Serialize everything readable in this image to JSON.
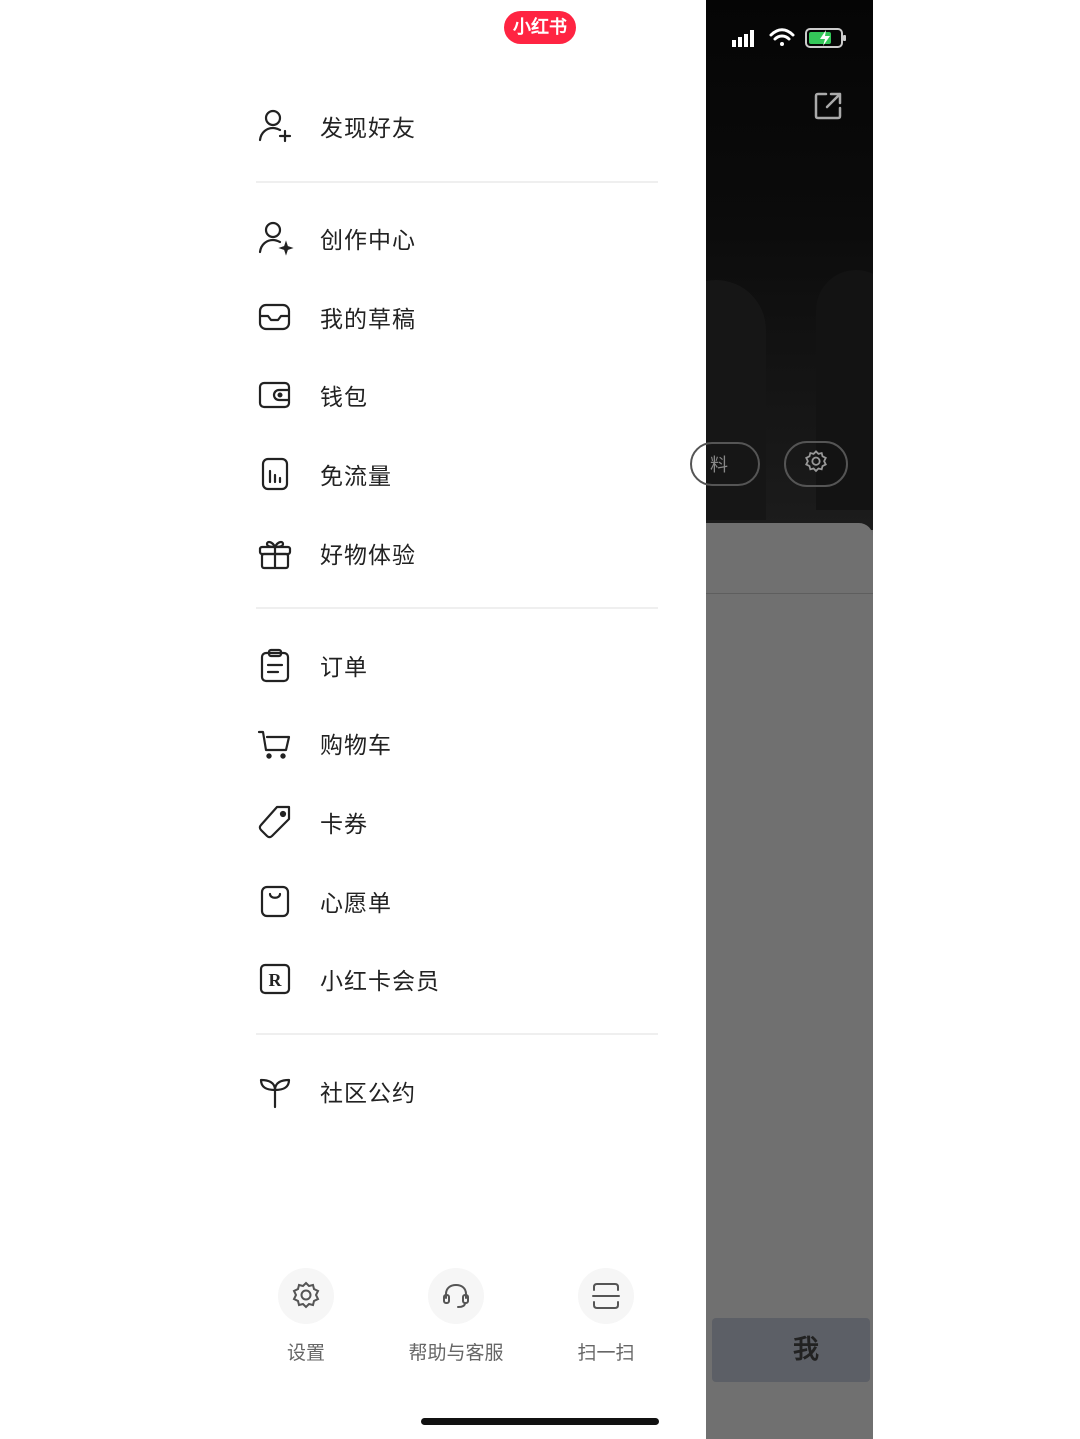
{
  "app": {
    "logo_text": "小红书",
    "brand_color": "#ff2442"
  },
  "drawer": {
    "groups": [
      {
        "items": [
          {
            "label": "发现好友",
            "icon": "add-friend-icon"
          }
        ]
      },
      {
        "items": [
          {
            "label": "创作中心",
            "icon": "creator-center-icon"
          },
          {
            "label": "我的草稿",
            "icon": "drafts-icon"
          },
          {
            "label": "钱包",
            "icon": "wallet-icon"
          },
          {
            "label": "免流量",
            "icon": "free-data-icon"
          },
          {
            "label": "好物体验",
            "icon": "gift-icon"
          }
        ]
      },
      {
        "items": [
          {
            "label": "订单",
            "icon": "clipboard-icon"
          },
          {
            "label": "购物车",
            "icon": "cart-icon"
          },
          {
            "label": "卡券",
            "icon": "coupon-tag-icon"
          },
          {
            "label": "心愿单",
            "icon": "wishlist-bag-icon"
          },
          {
            "label": "小红卡会员",
            "icon": "membership-r-icon"
          }
        ]
      },
      {
        "items": [
          {
            "label": "社区公约",
            "icon": "sprout-icon"
          }
        ]
      }
    ],
    "bottom_actions": [
      {
        "label": "设置",
        "icon": "gear-icon"
      },
      {
        "label": "帮助与客服",
        "icon": "headset-icon"
      },
      {
        "label": "扫一扫",
        "icon": "scan-icon"
      }
    ]
  },
  "underlay": {
    "partial_button_text": "料",
    "tab_me_label": "我"
  }
}
